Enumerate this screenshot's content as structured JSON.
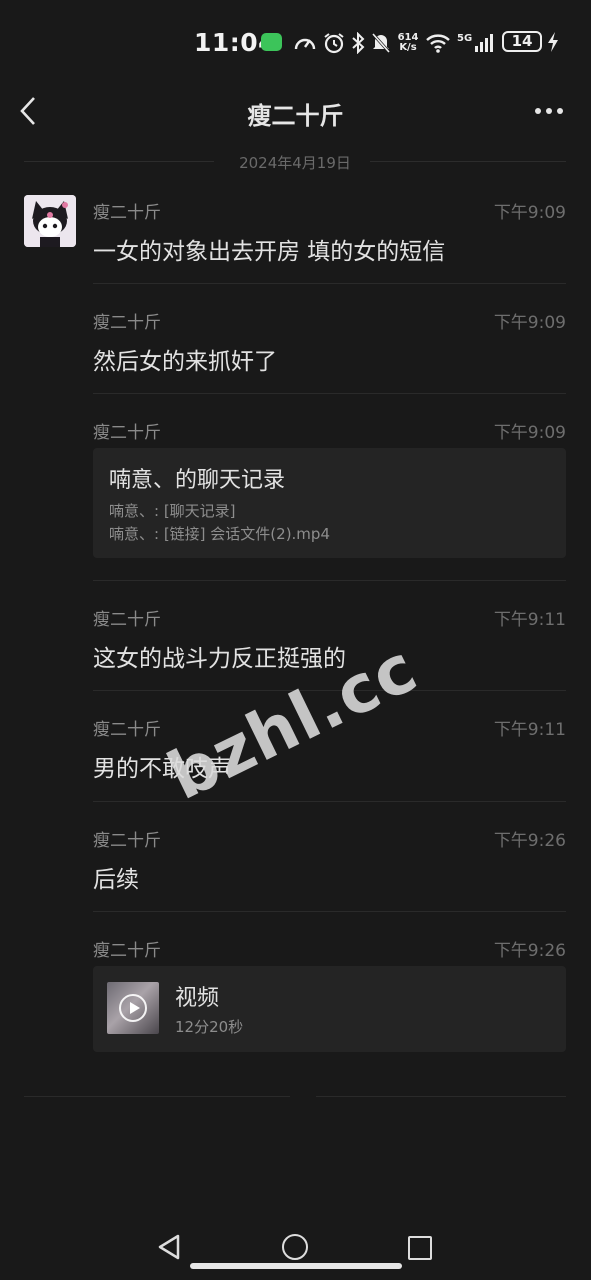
{
  "status_bar": {
    "time": "11:04",
    "net_speed_value": "614",
    "net_speed_unit": "K/s",
    "network": "5G",
    "battery": "14"
  },
  "header": {
    "title": "瘦二十斤"
  },
  "date_divider": "2024年4月19日",
  "messages": [
    {
      "sender": "瘦二十斤",
      "time": "下午9:09",
      "text": "一女的对象出去开房 填的女的短信"
    },
    {
      "sender": "瘦二十斤",
      "time": "下午9:09",
      "text": "然后女的来抓奸了"
    },
    {
      "sender": "瘦二十斤",
      "time": "下午9:09",
      "card": {
        "title": "喃意、的聊天记录",
        "lines": [
          "喃意、: [聊天记录]",
          "喃意、: [链接] 会话文件(2).mp4"
        ]
      }
    },
    {
      "sender": "瘦二十斤",
      "time": "下午9:11",
      "text": "这女的战斗力反正挺强的"
    },
    {
      "sender": "瘦二十斤",
      "time": "下午9:11",
      "text": "男的不敢吱声"
    },
    {
      "sender": "瘦二十斤",
      "time": "下午9:26",
      "text": "后续"
    },
    {
      "sender": "瘦二十斤",
      "time": "下午9:26",
      "video": {
        "title": "视频",
        "duration": "12分20秒"
      }
    }
  ],
  "watermark": "bzhl.cc",
  "icons": {
    "back": "chevron-left-icon",
    "more": "more-dots-icon",
    "play": "play-icon"
  }
}
